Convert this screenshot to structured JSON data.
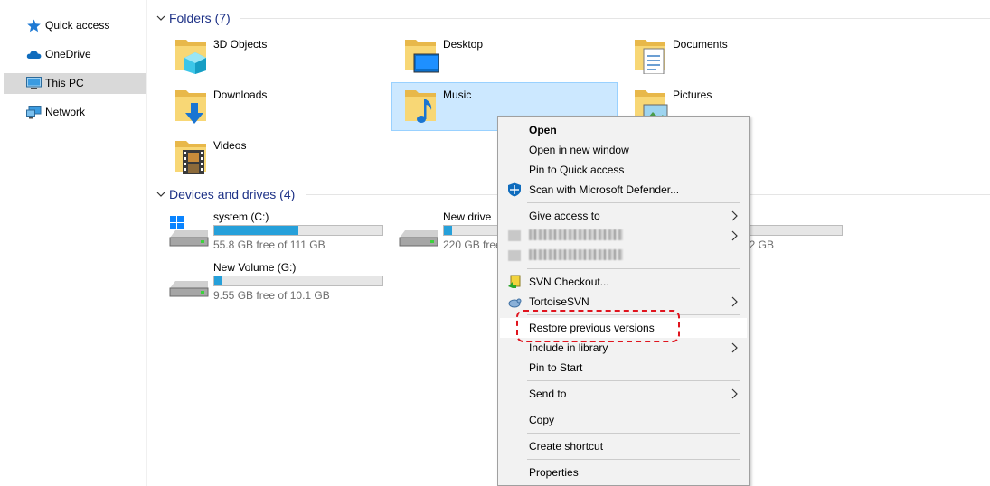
{
  "sidebar": {
    "items": [
      {
        "label": "Quick access",
        "icon": "star-icon"
      },
      {
        "label": "OneDrive",
        "icon": "cloud-icon"
      },
      {
        "label": "This PC",
        "icon": "computer-icon"
      },
      {
        "label": "Network",
        "icon": "network-icon"
      }
    ],
    "selected": "This PC"
  },
  "folders": {
    "title": "Folders (7)",
    "items": [
      {
        "name": "3D Objects"
      },
      {
        "name": "Desktop"
      },
      {
        "name": "Documents"
      },
      {
        "name": "Downloads"
      },
      {
        "name": "Music"
      },
      {
        "name": "Pictures"
      },
      {
        "name": "Videos"
      }
    ],
    "selected": "Music"
  },
  "drives": {
    "title": "Devices and drives (4)",
    "items": [
      {
        "name": "system (C:)",
        "free": "55.8 GB free of 111 GB",
        "used_fraction": 0.5
      },
      {
        "name": "New drive",
        "free": "220 GB free",
        "used_fraction": 0.05
      },
      {
        "name": "",
        "free": "22 GB",
        "used_fraction": 0.0
      },
      {
        "name": "New Volume (G:)",
        "free": "9.55 GB free of 10.1 GB",
        "used_fraction": 0.05
      }
    ]
  },
  "context_menu": {
    "items": [
      {
        "label": "Open"
      },
      {
        "label": "Open in new window"
      },
      {
        "label": "Pin to Quick access"
      },
      {
        "label": "Scan with Microsoft Defender..."
      },
      {
        "label": "Give access to"
      },
      {
        "label": "SVN Checkout..."
      },
      {
        "label": "TortoiseSVN"
      },
      {
        "label": "Restore previous versions"
      },
      {
        "label": "Include in library"
      },
      {
        "label": "Pin to Start"
      },
      {
        "label": "Send to"
      },
      {
        "label": "Copy"
      },
      {
        "label": "Create shortcut"
      },
      {
        "label": "Properties"
      }
    ],
    "highlighted": "Restore previous versions"
  },
  "colors": {
    "accent": "#26a0da",
    "selection_bg": "#cce8ff",
    "header_text": "#1e3287",
    "annotation": "#e0141e"
  }
}
